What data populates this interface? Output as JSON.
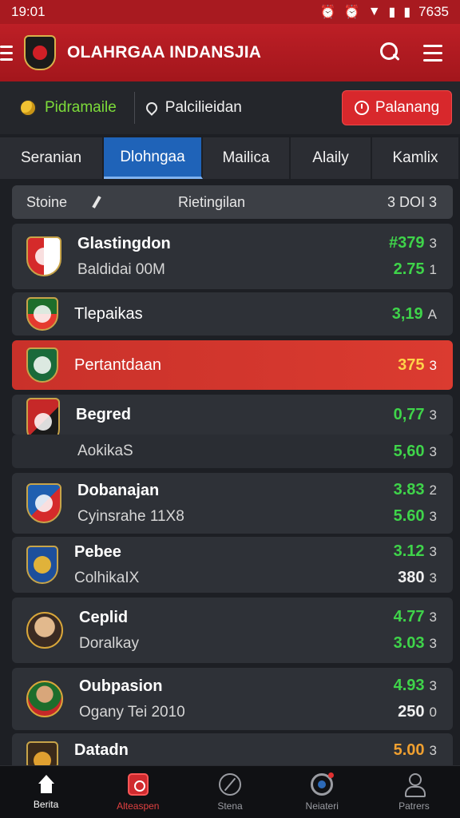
{
  "status_bar": {
    "time": "19:01",
    "right": "7635",
    "icons": [
      "alarm-icon",
      "alarm-icon",
      "wifi-icon",
      "signal-icon",
      "battery-icon"
    ]
  },
  "app_bar": {
    "title": "OLAHRGAA INDANSJIA",
    "icons": [
      "menu-icon",
      "team-logo",
      "search-icon",
      "menu-icon"
    ]
  },
  "filter": {
    "live_label": "Pidramaile",
    "location_label": "Palcilieidan",
    "cta_label": "Palanang",
    "colors": {
      "live": "#7ddc3a",
      "cta": "#d8282c"
    }
  },
  "tabs": [
    {
      "label": "Seranian",
      "active": false
    },
    {
      "label": "Dlohngaa",
      "active": true
    },
    {
      "label": "Mailica",
      "active": false
    },
    {
      "label": "Alaily",
      "active": false
    },
    {
      "label": "Kamlix",
      "active": false
    }
  ],
  "list_header": {
    "left": "Stoine",
    "mid": "Rietingilan",
    "right": "3 DOI 3"
  },
  "rows": [
    {
      "title": "Glastingdon",
      "sub": "Baldidai 00M",
      "value": "#379",
      "value_color": "#3fd44a",
      "value_suffix": "3",
      "value2": "2.75",
      "value2_color": "#3fd44a",
      "value2_suffix": "1",
      "crest": [
        "#d52a2a",
        "#ffffff"
      ]
    },
    {
      "title": "Tlepaikas",
      "sub": "",
      "value": "3,19",
      "value_color": "#3fd44a",
      "value_suffix": "A",
      "crest": [
        "#1e6e2b",
        "#e53a2e"
      ]
    },
    {
      "title": "Pertantdaan",
      "sub": "",
      "value": "375",
      "value_color": "#ffd24a",
      "value_suffix": "3",
      "highlight": true,
      "crest": [
        "#1a6a3a",
        "#f3f3f3"
      ]
    },
    {
      "title": "Begred",
      "sub": "",
      "value": "0,77",
      "value_color": "#3fd44a",
      "value_suffix": "3",
      "crest": [
        "#c62828",
        "#1a1a1a"
      ]
    },
    {
      "title": "",
      "sub": "AokikaS",
      "value": "5,60",
      "value_color": "#3fd44a",
      "value_suffix": "3"
    },
    {
      "title": "Dobanajan",
      "sub": "Cyinsrahe 11X8",
      "value": "3.83",
      "value_color": "#3fd44a",
      "value_suffix": "2",
      "value2": "5.60",
      "value2_color": "#3fd44a",
      "value2_suffix": "3",
      "crest": [
        "#1f5fb0",
        "#d52a2a"
      ]
    },
    {
      "title": "Pebee",
      "sub": "ColhikaIX",
      "value": "3.12",
      "value_color": "#3fd44a",
      "value_suffix": "3",
      "value2": "380",
      "value2_color": "#f0f0f0",
      "value2_suffix": "3",
      "crest": [
        "#1d4f9c",
        "#e0b23a"
      ]
    },
    {
      "title": "Ceplid",
      "sub": "Doralkay",
      "value": "4.77",
      "value_color": "#3fd44a",
      "value_suffix": "3",
      "value2": "3.03",
      "value2_color": "#3fd44a",
      "value2_suffix": "3",
      "avatar": true
    },
    {
      "title": "Oubpasion",
      "sub": "Ogany Tei 2010",
      "value": "4.93",
      "value_color": "#3fd44a",
      "value_suffix": "3",
      "value2": "250",
      "value2_color": "#f0f0f0",
      "value2_suffix": "0",
      "avatar": true
    },
    {
      "title": "Datadn",
      "sub": "",
      "value": "5.00",
      "value_color": "#f0a030",
      "value_suffix": "3",
      "crest": [
        "#3a2a1a",
        "#e0a030"
      ]
    }
  ],
  "bottom_nav": [
    {
      "label": "Berita",
      "icon": "home-icon",
      "state": "active"
    },
    {
      "label": "Alteaspen",
      "icon": "fixture-icon",
      "state": "accent"
    },
    {
      "label": "Stena",
      "icon": "bolt-icon",
      "state": ""
    },
    {
      "label": "Neiateri",
      "icon": "target-icon",
      "state": ""
    },
    {
      "label": "Patrers",
      "icon": "profile-icon",
      "state": ""
    }
  ]
}
